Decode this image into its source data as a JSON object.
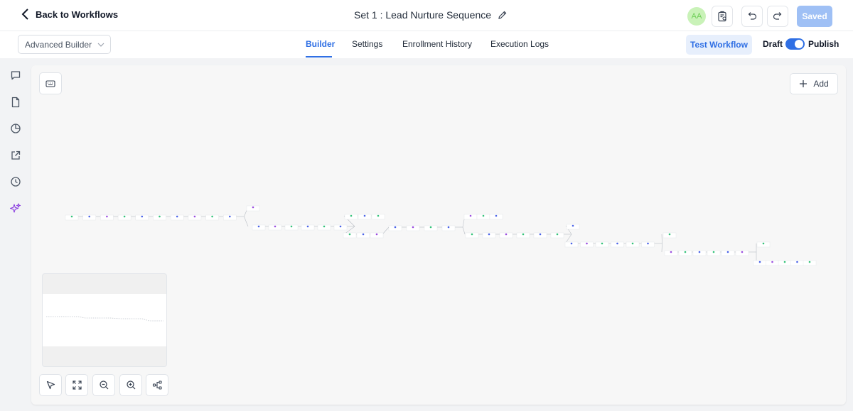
{
  "header": {
    "back_label": "Back to Workflows",
    "title": "Set 1 : Lead Nurture Sequence",
    "avatar_initials": "AA",
    "saved_label": "Saved"
  },
  "subheader": {
    "builder_mode": "Advanced Builder",
    "tabs": [
      {
        "label": "Builder",
        "active": true
      },
      {
        "label": "Settings",
        "active": false
      },
      {
        "label": "Enrollment History",
        "active": false
      },
      {
        "label": "Execution Logs",
        "active": false
      }
    ],
    "test_label": "Test Workflow",
    "draft_label": "Draft",
    "publish_label": "Publish",
    "publish_toggle_on": true
  },
  "sidebar": {
    "icons": [
      "chat-icon",
      "document-icon",
      "pie-chart-icon",
      "external-link-icon",
      "clock-icon",
      "sparkles-icon"
    ]
  },
  "canvas": {
    "add_label": "Add"
  },
  "colors": {
    "accent": "#2f6fe4",
    "saved_bg": "#9fc0f5",
    "avatar_bg": "#c9f2b8",
    "node_green": "#34c37a",
    "node_blue": "#4a63e8",
    "node_purple": "#9b4de0",
    "sparkle": "#8b3fe0"
  }
}
